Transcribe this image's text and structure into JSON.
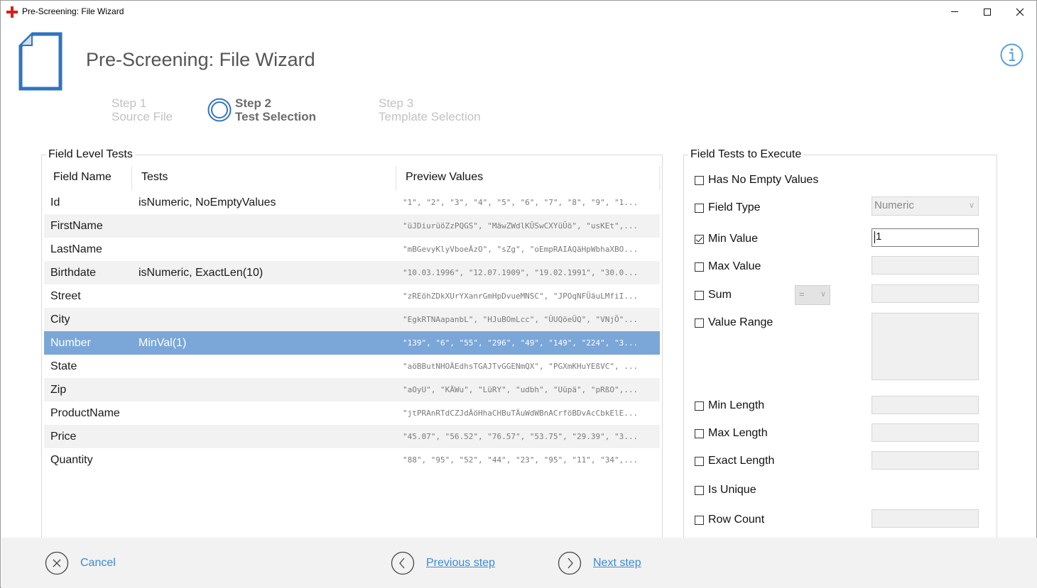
{
  "window": {
    "title": "Pre-Screening: File Wizard"
  },
  "header": {
    "title": "Pre-Screening: File Wizard"
  },
  "steps": [
    {
      "num": "Step  1",
      "name": "Source File",
      "state": "inactive"
    },
    {
      "num": "Step 2",
      "name": "Test Selection",
      "state": "active"
    },
    {
      "num": "Step  3",
      "name": "Template Selection",
      "state": "inactive"
    }
  ],
  "field_level_tests": {
    "legend": "Field Level Tests",
    "columns": [
      "Field Name",
      "Tests",
      "Preview Values"
    ],
    "rows": [
      {
        "name": "Id",
        "tests": "isNumeric, NoEmptyValues",
        "preview": "\"1\", \"2\", \"3\", \"4\", \"5\", \"6\", \"7\", \"8\", \"9\", \"1..."
      },
      {
        "name": "FirstName",
        "tests": "",
        "preview": "\"üJDiurüöZzPQGS\", \"MäwZWdlKÜSwCXYüÜö\", \"usKEt\",..."
      },
      {
        "name": "LastName",
        "tests": "",
        "preview": "\"mBGevyKlyVboeÄzO\", \"sZg\", \"oEmpRAIAQäHpWbhaXBO..."
      },
      {
        "name": "Birthdate",
        "tests": "isNumeric, ExactLen(10)",
        "preview": "\"10.03.1996\", \"12.07.1909\", \"19.02.1991\", \"30.0..."
      },
      {
        "name": "Street",
        "tests": "",
        "preview": "\"zREöhZDkXUrYXanrGmHpDvueMNSC\", \"JPOqNFÜäuLMfiI..."
      },
      {
        "name": "City",
        "tests": "",
        "preview": "\"EgkRTNAapanbL\", \"HJuBOmLcc\", \"ÜUQöeÜQ\", \"VNjÖ\"..."
      },
      {
        "name": "Number",
        "tests": "MinVal(1)",
        "preview": "\"139\", \"6\", \"55\", \"296\", \"49\", \"149\", \"224\", \"3...",
        "selected": true
      },
      {
        "name": "State",
        "tests": "",
        "preview": "\"aöBButNHOÄEdhsTGAJTvGGENmQX\", \"PGXmKHuYEßVC\", ..."
      },
      {
        "name": "Zip",
        "tests": "",
        "preview": "\"aOyU\", \"KÄWu\", \"LüRY\", \"udbh\", \"Uüpä\", \"pRßO\",..."
      },
      {
        "name": "ProductName",
        "tests": "",
        "preview": "\"jtPRAnRTdCZJdÄöHhaCHBuTÄuWdWBnACrföBDvAcCbkElE..."
      },
      {
        "name": "Price",
        "tests": "",
        "preview": "\"45.07\", \"56.52\", \"76.57\", \"53.75\", \"29.39\", \"3..."
      },
      {
        "name": "Quantity",
        "tests": "",
        "preview": "\"88\", \"95\", \"52\", \"44\", \"23\", \"95\", \"11\", \"34\",..."
      }
    ]
  },
  "field_tests": {
    "legend": "Field Tests to Execute",
    "has_no_empty": {
      "label": "Has No Empty Values",
      "checked": false
    },
    "field_type": {
      "label": "Field Type",
      "checked": false,
      "value": "Numeric"
    },
    "min_value": {
      "label": "Min Value",
      "checked": true,
      "value": "1"
    },
    "max_value": {
      "label": "Max Value",
      "checked": false
    },
    "sum": {
      "label": "Sum",
      "checked": false,
      "operator": "="
    },
    "value_range": {
      "label": "Value Range",
      "checked": false
    },
    "min_length": {
      "label": "Min Length",
      "checked": false
    },
    "max_length": {
      "label": "Max Length",
      "checked": false
    },
    "exact_length": {
      "label": "Exact Length",
      "checked": false
    },
    "is_unique": {
      "label": "Is Unique",
      "checked": false
    },
    "row_count": {
      "label": "Row Count",
      "checked": false
    }
  },
  "footer": {
    "cancel": "Cancel",
    "previous": "Previous step",
    "next": "Next step"
  },
  "colors": {
    "accent": "#2f74c0",
    "link": "#3a8ad6",
    "selection": "#7ba6d8"
  }
}
